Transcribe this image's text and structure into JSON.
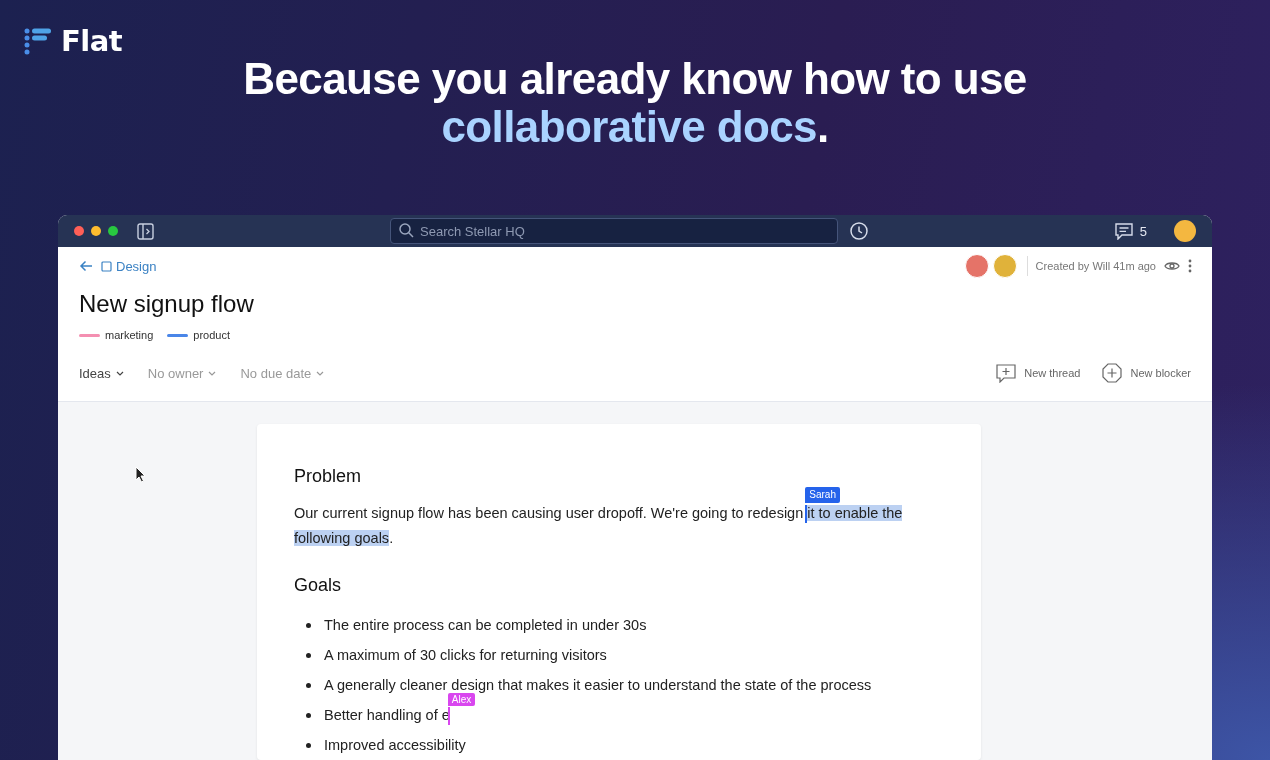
{
  "brand": {
    "name": "Flat"
  },
  "headline": {
    "line1": "Because you already know how to use",
    "highlight": "collaborative docs",
    "tail": "."
  },
  "app": {
    "search": {
      "placeholder": "Search Stellar HQ"
    },
    "comment_count": "5",
    "breadcrumb": "Design",
    "meta": "Created by Will 41m ago",
    "title": "New signup flow",
    "tags": [
      {
        "label": "marketing",
        "color": "#f48fb1"
      },
      {
        "label": "product",
        "color": "#4a86e8"
      }
    ],
    "filters": [
      {
        "label": "Ideas",
        "set": true
      },
      {
        "label": "No owner",
        "set": false
      },
      {
        "label": "No due date",
        "set": false
      }
    ],
    "actions": [
      {
        "label": "New thread",
        "kind": "thread"
      },
      {
        "label": "New blocker",
        "kind": "blocker"
      }
    ],
    "doc": {
      "heading1": "Problem",
      "paragraph": {
        "before": "Our current signup flow has been causing user dropoff. We're going to redesign ",
        "selected": [
          "it to enable the",
          "following goals"
        ],
        "after": ".",
        "cursor": {
          "name": "Sarah",
          "color": "#2563eb"
        }
      },
      "heading2": "Goals",
      "goals": [
        {
          "text": "The entire process can be completed in under 30s"
        },
        {
          "text": "A maximum of 30 clicks for returning visitors"
        },
        {
          "text": "A generally cleaner design that makes it easier to understand the state of the process"
        },
        {
          "text": "Better handling of e",
          "cursor": {
            "name": "Alex",
            "color": "#d946ef"
          }
        },
        {
          "text": "Improved accessibility"
        }
      ]
    }
  }
}
